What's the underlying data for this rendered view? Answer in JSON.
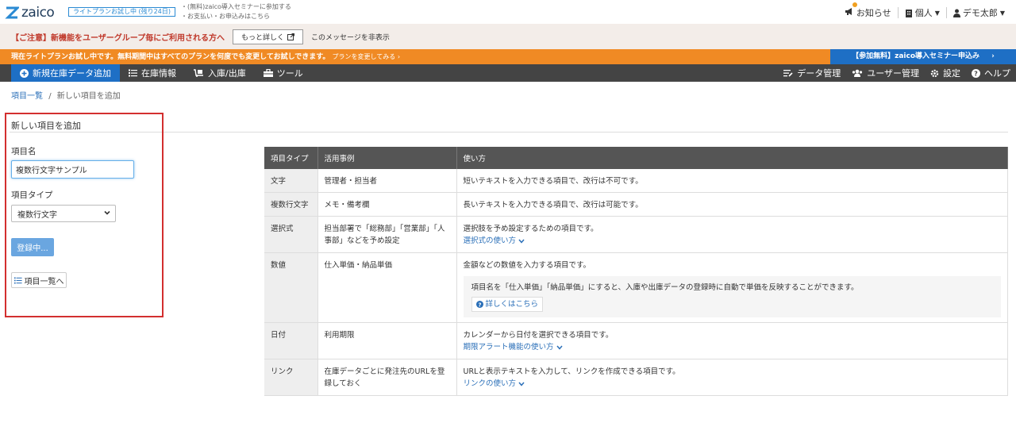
{
  "header": {
    "logo_text": "zaico",
    "trial_badge": "ライトプランお試し中 (残り24日)",
    "seminar_line1": "・(無料)zaico導入セミナーに参加する",
    "seminar_line2": "・お支払い・お申込みはこちら",
    "notifications_label": "お知らせ",
    "account_type_label": "個人",
    "user_label": "デモ太郎"
  },
  "caution": {
    "text": "【ご注意】新機能をユーザーグループ毎にご利用される方へ",
    "more_button": "もっと詳しく",
    "hide_label": "このメッセージを非表示"
  },
  "trial_bar": {
    "text": "現在ライトプランお試し中です。無料期間中はすべてのプランを何度でも変更してお試しできます。",
    "change_link": "プランを変更してみる",
    "seminar_cta": "【参加無料】zaico導入セミナー申込み"
  },
  "nav": {
    "new_item": "新規在庫データ追加",
    "inventory": "在庫情報",
    "in_out": "入庫/出庫",
    "tools": "ツール",
    "data_mgmt": "データ管理",
    "user_mgmt": "ユーザー管理",
    "settings": "設定",
    "help": "ヘルプ"
  },
  "breadcrumb": {
    "parent": "項目一覧",
    "separator": "/",
    "current": "新しい項目を追加"
  },
  "form": {
    "section_title": "新しい項目を追加",
    "name_label": "項目名",
    "name_value": "複数行文字サンプル",
    "type_label": "項目タイプ",
    "type_value": "複数行文字",
    "submit_label": "登録中...",
    "back_label": "項目一覧へ"
  },
  "type_table": {
    "headers": [
      "項目タイプ",
      "活用事例",
      "使い方"
    ],
    "rows": [
      {
        "type": "文字",
        "example": "管理者・担当者",
        "usage": "短いテキストを入力できる項目で、改行は不可です。"
      },
      {
        "type": "複数行文字",
        "example": "メモ・備考欄",
        "usage": "長いテキストを入力できる項目で、改行は可能です。"
      },
      {
        "type": "選択式",
        "example": "担当部署で「総務部」「営業部」「人事部」などを予め設定",
        "usage": "選択肢を予め設定するための項目です。",
        "link": "選択式の使い方"
      },
      {
        "type": "数値",
        "example": "仕入単価・納品単価",
        "usage": "金額などの数値を入力する項目です。",
        "hint": "項目名を「仕入単価」「納品単価」にすると、入庫や出庫データの登録時に自動で単価を反映することができます。",
        "hint_button": "詳しくはこちら"
      },
      {
        "type": "日付",
        "example": "利用期限",
        "usage": "カレンダーから日付を選択できる項目です。",
        "link": "期限アラート機能の使い方"
      },
      {
        "type": "リンク",
        "example": "在庫データごとに発注先のURLを登録しておく",
        "usage": "URLと表示テキストを入力して、リンクを作成できる項目です。",
        "link": "リンクの使い方"
      }
    ]
  },
  "colors": {
    "accent_blue": "#1e6fc5",
    "orange_bar": "#f08a24",
    "nav_bg": "#444444",
    "highlight_red": "#d32f2f"
  }
}
